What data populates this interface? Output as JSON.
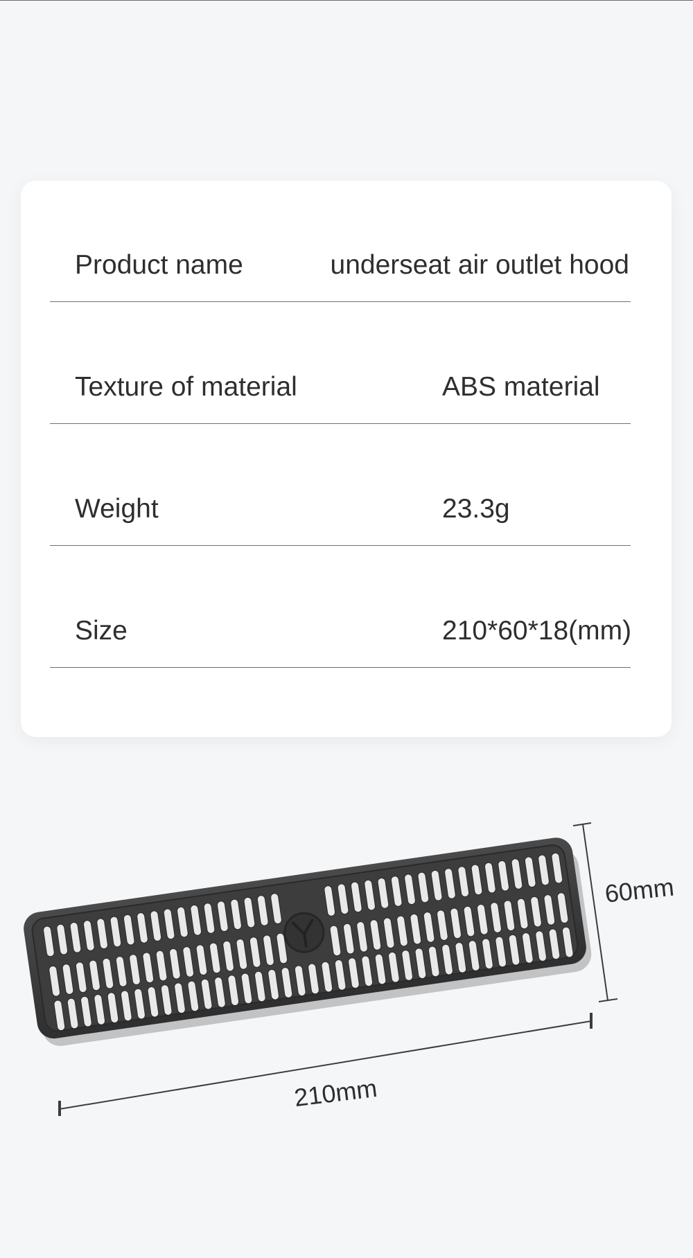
{
  "spec_table": {
    "rows": [
      {
        "label": "Product name",
        "value": "underseat air outlet hood"
      },
      {
        "label": "Texture of material",
        "value": "ABS material"
      },
      {
        "label": "Weight",
        "value": "23.3g"
      },
      {
        "label": "Size",
        "value": "210*60*18(mm)"
      }
    ]
  },
  "product_image": {
    "height_label": "60mm",
    "length_label": "210mm",
    "grille_color": "#3a3a3a",
    "dimension_line_color": "#3c3c3c"
  }
}
